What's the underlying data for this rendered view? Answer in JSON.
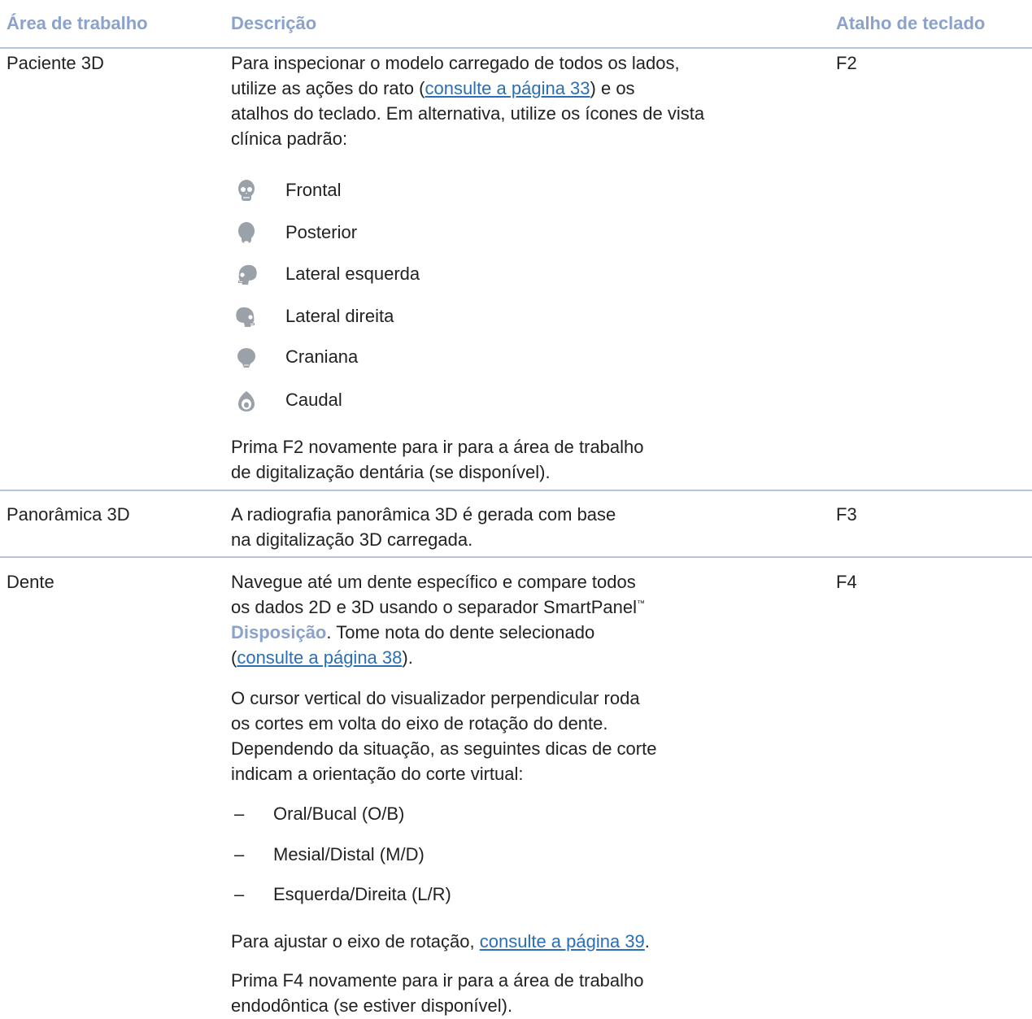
{
  "header": {
    "col1": "Área de trabalho",
    "col2": "Descrição",
    "col3": "Atalho de teclado"
  },
  "rows": [
    {
      "area": "Paciente 3D",
      "shortcut": "F2",
      "desc_line1": "Para inspecionar o modelo carregado de todos os lados,",
      "desc_line2_pre": "utilize as ações do rato (",
      "desc_link": "consulte a página 33",
      "desc_line2_post": ") e os",
      "desc_line3": "atalhos do teclado. Em alternativa, utilize os ícones de vista",
      "desc_line4": "clínica padrão:",
      "views": [
        {
          "icon": "skull-frontal-icon",
          "label": "Frontal"
        },
        {
          "icon": "skull-posterior-icon",
          "label": "Posterior"
        },
        {
          "icon": "skull-left-lateral-icon",
          "label": "Lateral esquerda"
        },
        {
          "icon": "skull-right-lateral-icon",
          "label": "Lateral direita"
        },
        {
          "icon": "skull-cranial-icon",
          "label": "Craniana"
        },
        {
          "icon": "skull-caudal-icon",
          "label": "Caudal"
        }
      ],
      "note_line1": "Prima F2 novamente para ir para a área de trabalho",
      "note_line2": "de digitalização dentária (se disponível)."
    },
    {
      "area": "Panorâmica 3D",
      "shortcut": "F3",
      "desc_line1": "A radiografia panorâmica 3D é gerada com base",
      "desc_line2": "na digitalização 3D carregada."
    },
    {
      "area": "Dente",
      "shortcut": "F4",
      "p1_line1": "Navegue até um dente específico e compare todos",
      "p1_line2_pre": "os dados 2D e 3D usando o separador SmartPanel",
      "p1_tm": "™",
      "p1_line3_bold": "Disposição",
      "p1_line3_post": ". Tome nota do dente selecionado",
      "p1_line4_pre": "(",
      "p1_link": "consulte a página 38",
      "p1_line4_post": ").",
      "p2_line1": "O cursor vertical do visualizador perpendicular roda",
      "p2_line2": "os cortes em volta do eixo de rotação do dente.",
      "p2_line3": "Dependendo da situação, as seguintes dicas de corte",
      "p2_line4": "indicam a orientação do corte virtual:",
      "dash": "–",
      "hints": [
        "Oral/Bucal (O/B)",
        "Mesial/Distal (M/D)",
        "Esquerda/Direita (L/R)"
      ],
      "p3_pre": "Para ajustar o eixo de rotação, ",
      "p3_link": "consulte a página 39",
      "p3_post": ".",
      "p4_line1": "Prima F4 novamente para ir para a área de trabalho",
      "p4_line2": "endodôntica (se estiver disponível)."
    }
  ]
}
